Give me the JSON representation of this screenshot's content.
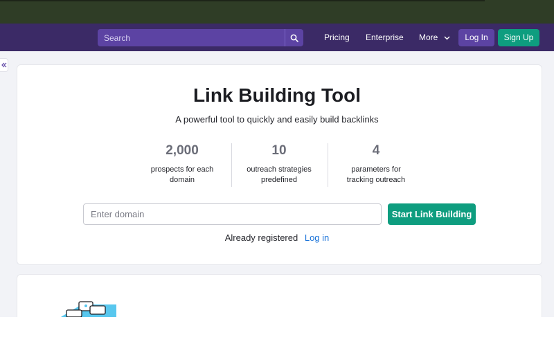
{
  "navbar": {
    "search_placeholder": "Search",
    "links": {
      "pricing": "Pricing",
      "enterprise": "Enterprise",
      "more": "More"
    },
    "login_label": "Log In",
    "signup_label": "Sign Up"
  },
  "hero": {
    "title": "Link Building Tool",
    "subtitle": "A powerful tool to quickly and easily build backlinks",
    "stats": [
      {
        "value": "2,000",
        "label_line1": "prospects for each",
        "label_line2": "domain"
      },
      {
        "value": "10",
        "label_line1": "outreach strategies",
        "label_line2": "predefined"
      },
      {
        "value": "4",
        "label_line1": "parameters for",
        "label_line2": "tracking outreach"
      }
    ],
    "domain_placeholder": "Enter domain",
    "start_button": "Start Link Building",
    "registered_text": "Already registered",
    "login_link": "Log in"
  },
  "colors": {
    "navbar": "#3b2a66",
    "accent_green": "#0e9d7f",
    "link_blue": "#1a73d9"
  }
}
